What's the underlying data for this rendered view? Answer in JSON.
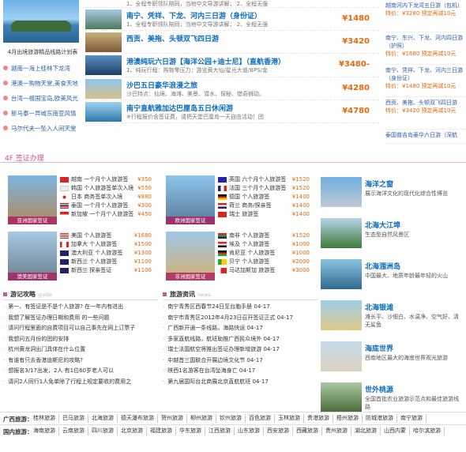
{
  "promo": {
    "caption": "4月出境旅游精品线路计划表",
    "items": [
      "越南一海上桂林下龙湾",
      "港澳一购物天堂,美食天地",
      "台湾一祖国宝岛,欧美风光",
      "新马泰一异域东南亚风情",
      "马尔代夫一坠入人间天堂"
    ]
  },
  "tours": [
    {
      "title": "",
      "desc": "1、全程专职领队陪同，当地中文导游讲解； 2、全程无强",
      "price": ""
    },
    {
      "title": "南宁、凭祥、下龙、河内三日游（身份证）",
      "desc": "1、全程专职领队陪同，当地中文导游讲解； 2、全程无强",
      "price": "¥1480"
    },
    {
      "title": "西贡、美拖、头顿双飞四日游",
      "desc": "",
      "price": "¥3420"
    },
    {
      "title": "港澳纯玩六日游【海洋公园+迪士尼】（直航香港）",
      "desc": "1、纯玩行程：购物零压力；游览黄大仙/星光大道/BPS/金",
      "price": "¥3480-"
    },
    {
      "title": "沙巴五日豪华浪漫之旅",
      "desc": "沙巴特点：仙境、海滩、美景、潜水、探秘、猎奇狮动。",
      "price": "¥4280"
    },
    {
      "title": "南宁直航雅加达巴厘岛五日休闲游",
      "desc": "※行程报价含签证费，请把天堂巴厘岛一天自由活动！团",
      "price": "¥4780"
    }
  ],
  "deals": [
    {
      "name": "越南河内下龙湾五日游（包机）",
      "price": "特价：¥3280 预定再减10元"
    },
    {
      "name": "南宁、东兴、下龙、河内四日游（护照）",
      "price": "特价：¥1680 预定再减10元"
    },
    {
      "name": "南宁、凭祥、下龙、河内三日游（身份证）",
      "price": "特价：¥1480 预定再减10元"
    },
    {
      "name": "西贡、美拖、头顿双飞四日游",
      "price": "特价：¥3420 预定再减10元"
    },
    {
      "name": "泰国普吉岛豪华六日游（深航",
      "price": ""
    }
  ],
  "section": {
    "title": "4F 签证办理"
  },
  "visa": [
    {
      "label": "亚洲国家签证",
      "rows": [
        [
          "越南 一个月个人旅游签",
          "¥350"
        ],
        [
          "韩国 个人旅游签单次入境",
          "¥550"
        ],
        [
          "日本 商务签单次入境",
          "¥880"
        ],
        [
          "泰国 一个月个人旅游签",
          "¥300"
        ],
        [
          "新加坡 一个月个人旅游签",
          "¥450"
        ]
      ]
    },
    {
      "label": "欧洲国家签证",
      "rows": [
        [
          "英国 六个月个人旅游签",
          "¥1520"
        ],
        [
          "法国 三个月个人旅游签",
          "¥1520"
        ],
        [
          "德国 个人旅游签",
          "¥1400"
        ],
        [
          "荷兰 商务/探亲签",
          "¥1400"
        ],
        [
          "瑞士 旅游签",
          "¥1400"
        ]
      ]
    },
    {
      "label": "澳美国家签证",
      "rows": [
        [
          "美国 个人旅游签",
          "¥1680"
        ],
        [
          "加拿大 个人旅游签",
          "¥1500"
        ],
        [
          "澳大利亚 个人旅游签",
          "¥1300"
        ],
        [
          "新西兰 个人旅游签",
          "¥1100"
        ],
        [
          "新西兰 探亲签证",
          "¥1100"
        ]
      ]
    },
    {
      "label": "非洲国家签证",
      "rows": [
        [
          "南非 个人旅游签",
          "¥1520"
        ],
        [
          "埃及 个人旅游签",
          "¥1000"
        ],
        [
          "肯尼亚 个人旅游签",
          "¥1000"
        ],
        [
          "贝宁 个人旅游签",
          "¥2000"
        ],
        [
          "马达加斯加 旅游签",
          "¥3000"
        ]
      ]
    }
  ],
  "attractions": [
    {
      "name": "海洋之窗",
      "desc": "展示海洋文化的现代化综合性博览"
    },
    {
      "name": "北海大江埠",
      "desc": "生态型自然风景区"
    },
    {
      "name": "北海涠洲岛",
      "desc": "中国最大、地质年龄最年轻的火山"
    },
    {
      "name": "北海银滩",
      "desc": "滩长平、沙细白、水温净、空气好、清无鲨鱼"
    },
    {
      "name": "海底世界",
      "desc": "西南地区最大的海底世界观光旅游"
    },
    {
      "name": "世外桃源",
      "desc": "全国首批农业旅游示范点和最佳旅游线路"
    }
  ],
  "news_left": {
    "title": "游记攻略",
    "tag": "guide",
    "items": [
      "第一、有签证是不是个人旅游?  在一年内有进出",
      "我想了解签证办理日期和费用  的一些问题",
      "请问行程里面的自费项目可以自己事先在网上订票子",
      "我想问五月份的团的安排",
      "杭州黄龙洞出门具体在什么位置",
      "有谁有只去香港迪斯尼的攻略?",
      "想报名3/17出发，2人 有1位60岁老人可以",
      "请问2人同行1人免单除了行程上规定要收的费用之"
    ]
  },
  "news_right": {
    "title": "旅游资讯",
    "tag": "news",
    "items": [
      "南宁青秀区西春节24日至台胞手册 04-17",
      "南宁市青秀区2012年4月23日召开签证正式 04-17",
      "广西新开通一条线路，海路快运 04-17",
      "多家直航线路，航班助推广西民众境外 04-17",
      "瑞士法国航空将推出签证办理新增旅游 04-17",
      "中越首三国联合开展边境文化节 04-17",
      "陕西1名游客在台湾坠海身亡 04-17",
      "第九届国际台北商展北京直航航班 04-17"
    ]
  },
  "links": [
    {
      "head": "广西旅游：",
      "items": [
        "桂林旅游",
        "巴马旅游",
        "北海旅游",
        "德天瀑布旅游",
        "贺州旅游",
        "柳州旅游",
        "钦州旅游",
        "百色旅游",
        "玉林旅游",
        "贵港旅游",
        "梧州旅游",
        "防城港旅游",
        "南宁旅游"
      ]
    },
    {
      "head": "国内旅游：",
      "items": [
        "海南旅游",
        "云南旅游",
        "四川旅游",
        "北京旅游",
        "福建旅游",
        "华东旅游",
        "江西旅游",
        "山东旅游",
        "西安旅游",
        "西藏旅游",
        "贵州旅游",
        "湖北旅游",
        "山西内蒙",
        "哈尔滨旅游"
      ]
    }
  ]
}
